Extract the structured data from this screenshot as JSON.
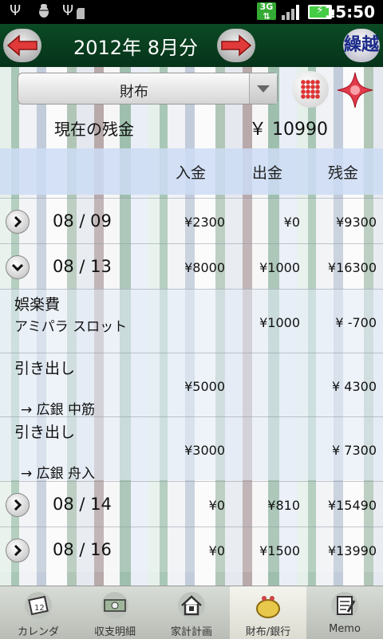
{
  "status_bar": {
    "network": "3G",
    "time": "15:50",
    "icons": [
      "usb-icon",
      "debug-bug-icon",
      "usb-icon",
      "sd-card-icon",
      "signal-icon",
      "battery-charging-icon"
    ]
  },
  "header": {
    "title": "2012年 8月分",
    "carry_over_label": "繰越"
  },
  "wallet": {
    "selected": "財布",
    "balance_label": "現在の残金",
    "balance_value": "￥ 10990"
  },
  "columns": {
    "income": "入金",
    "expense": "出金",
    "balance": "残金"
  },
  "rows": [
    {
      "kind": "date",
      "date": "08 / 09",
      "expanded": false,
      "income": "¥2300",
      "expense": "¥0",
      "balance": "¥9300"
    },
    {
      "kind": "date",
      "date": "08 / 13",
      "expanded": true,
      "income": "¥8000",
      "expense": "¥1000",
      "balance": "¥16300"
    },
    {
      "kind": "detail",
      "category": "娯楽費",
      "memo": "アミパラ スロット",
      "income": "",
      "expense": "¥1000",
      "balance": "¥ -700"
    },
    {
      "kind": "detail",
      "category": "引き出し",
      "memo": "→ 広銀 中筋",
      "income": "¥5000",
      "expense": "",
      "balance": "¥ 4300"
    },
    {
      "kind": "detail",
      "category": "引き出し",
      "memo": "→ 広銀 舟入",
      "income": "¥3000",
      "expense": "",
      "balance": "¥ 7300"
    },
    {
      "kind": "date",
      "date": "08 / 14",
      "expanded": false,
      "income": "¥0",
      "expense": "¥810",
      "balance": "¥15490"
    },
    {
      "kind": "date",
      "date": "08 / 16",
      "expanded": false,
      "income": "¥0",
      "expense": "¥1500",
      "balance": "¥13990"
    }
  ],
  "tabs": [
    {
      "label": "カレンダ",
      "icon": "calendar-icon",
      "active": false
    },
    {
      "label": "収支明細",
      "icon": "money-icon",
      "active": false
    },
    {
      "label": "家計計画",
      "icon": "house-icon",
      "active": false
    },
    {
      "label": "財布/銀行",
      "icon": "purse-icon",
      "active": true
    },
    {
      "label": "Memo",
      "icon": "memo-icon",
      "active": false
    }
  ],
  "colors": {
    "header_bg": "#06331a",
    "arrow": "#e03a3a",
    "carry_over_text": "#1a2a8a",
    "column_header_bg": "#cddcf5"
  }
}
